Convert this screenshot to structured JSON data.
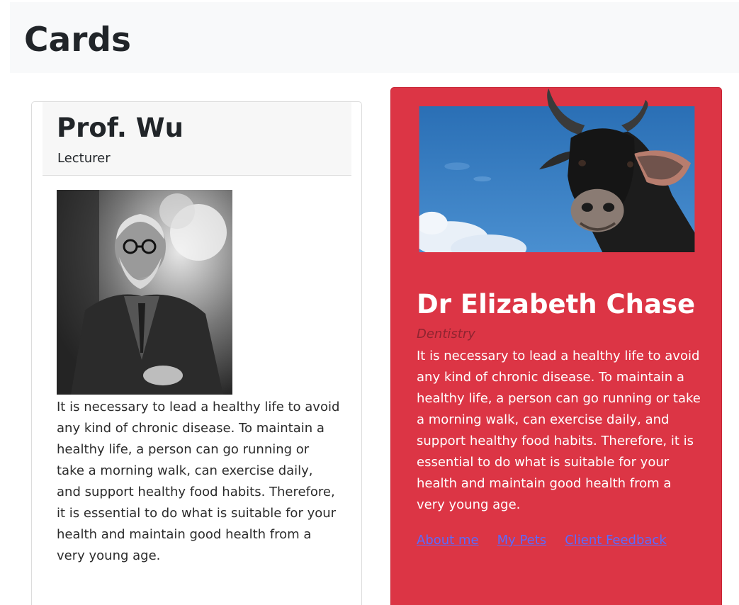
{
  "page": {
    "title": "Cards"
  },
  "card_left": {
    "name": "Prof. Wu",
    "role": "Lecturer",
    "text": "It is necessary to lead a healthy life to avoid any kind of chronic disease. To maintain a healthy life, a person can go running or take a morning walk, can exercise daily, and support healthy food habits. Therefore, it is essential to do what is suitable for your health and maintain good health from a very young age."
  },
  "card_right": {
    "name": "Dr Elizabeth Chase",
    "role": "Dentistry",
    "text": "It is necessary to lead a healthy life to avoid any kind of chronic disease. To maintain a healthy life, a person can go running or take a morning walk, can exercise daily, and support healthy food habits. Therefore, it is essential to do what is suitable for your health and maintain good health from a very young age.",
    "links": [
      "About me",
      "My Pets",
      "Client Feedback"
    ],
    "background_color": "#dc3545"
  }
}
